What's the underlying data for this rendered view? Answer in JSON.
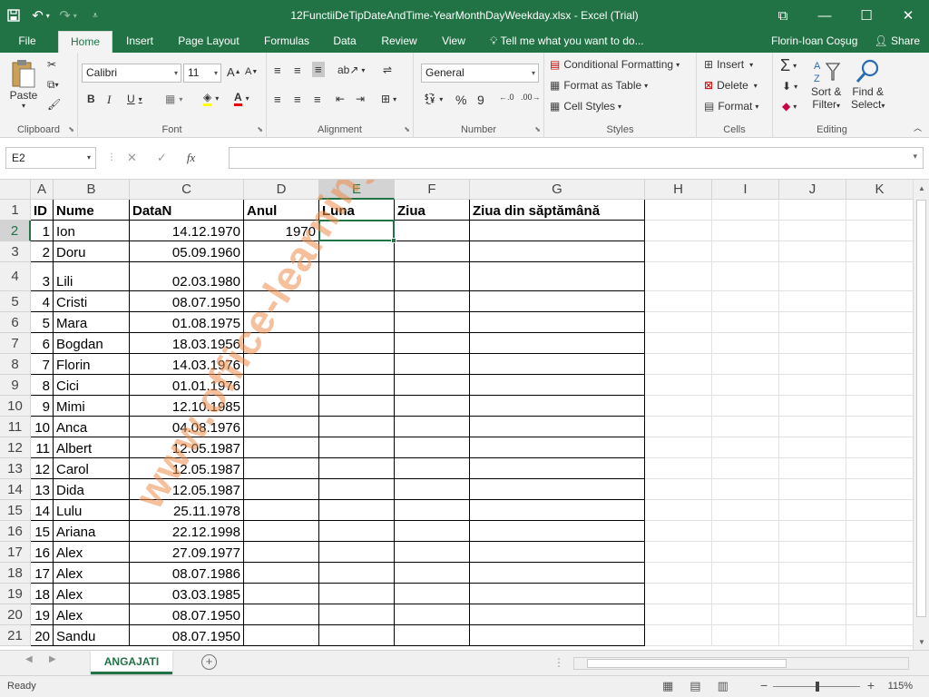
{
  "window": {
    "title": "12FunctiiDeTipDateAndTime-YearMonthDayWeekday.xlsx - Excel (Trial)",
    "save_icon": "save-icon",
    "undo_icon": "undo-icon",
    "redo_icon": "redo-icon"
  },
  "tabs": {
    "items": [
      "File",
      "Home",
      "Insert",
      "Page Layout",
      "Formulas",
      "Data",
      "Review",
      "View"
    ],
    "active": "Home",
    "tell_me": "Tell me what you want to do...",
    "user": "Florin-Ioan Coşug",
    "share": "Share"
  },
  "ribbon": {
    "clipboard": {
      "label": "Clipboard",
      "paste": "Paste"
    },
    "font": {
      "label": "Font",
      "name": "Calibri",
      "size": "11",
      "grow": "A",
      "shrink": "A",
      "bold": "B",
      "italic": "I",
      "underline": "U",
      "font_color": "A"
    },
    "alignment": {
      "label": "Alignment"
    },
    "number": {
      "label": "Number",
      "format": "General",
      "percent": "%",
      "comma": "9"
    },
    "styles": {
      "label": "Styles",
      "conditional": "Conditional Formatting",
      "format_table": "Format as Table",
      "cell_styles": "Cell Styles"
    },
    "cells": {
      "label": "Cells",
      "insert": "Insert",
      "delete": "Delete",
      "format": "Format"
    },
    "editing": {
      "label": "Editing",
      "sort1": "Sort &",
      "sort2": "Filter",
      "find1": "Find &",
      "find2": "Select",
      "sigma": "Σ"
    }
  },
  "formula_bar": {
    "name_box": "E2",
    "cancel": "✕",
    "enter": "✓",
    "fx": "fx",
    "content": ""
  },
  "sheet": {
    "columns": [
      "A",
      "B",
      "C",
      "D",
      "E",
      "F",
      "G",
      "H",
      "I",
      "J",
      "K"
    ],
    "rows": [
      "1",
      "2",
      "3",
      "4",
      "5",
      "6",
      "7",
      "8",
      "9",
      "10",
      "11",
      "12",
      "13",
      "14",
      "15",
      "16",
      "17",
      "18",
      "19",
      "20",
      "21"
    ],
    "headers": [
      "ID",
      "Nume",
      "DataN",
      "Anul",
      "Luna",
      "Ziua",
      "Ziua din săptămână"
    ],
    "data": [
      [
        "1",
        "Ion",
        "14.12.1970",
        "1970",
        "",
        "",
        ""
      ],
      [
        "2",
        "Doru",
        "05.09.1960",
        "",
        "",
        "",
        ""
      ],
      [
        "3",
        "Lili",
        "02.03.1980",
        "",
        "",
        "",
        ""
      ],
      [
        "4",
        "Cristi",
        "08.07.1950",
        "",
        "",
        "",
        ""
      ],
      [
        "5",
        "Mara",
        "01.08.1975",
        "",
        "",
        "",
        ""
      ],
      [
        "6",
        "Bogdan",
        "18.03.1956",
        "",
        "",
        "",
        ""
      ],
      [
        "7",
        "Florin",
        "14.03.1976",
        "",
        "",
        "",
        ""
      ],
      [
        "8",
        "Cici",
        "01.01.1976",
        "",
        "",
        "",
        ""
      ],
      [
        "9",
        "Mimi",
        "12.10.1985",
        "",
        "",
        "",
        ""
      ],
      [
        "10",
        "Anca",
        "04.08.1976",
        "",
        "",
        "",
        ""
      ],
      [
        "11",
        "Albert",
        "12.05.1987",
        "",
        "",
        "",
        ""
      ],
      [
        "12",
        "Carol",
        "12.05.1987",
        "",
        "",
        "",
        ""
      ],
      [
        "13",
        "Dida",
        "12.05.1987",
        "",
        "",
        "",
        ""
      ],
      [
        "14",
        "Lulu",
        "25.11.1978",
        "",
        "",
        "",
        ""
      ],
      [
        "15",
        "Ariana",
        "22.12.1998",
        "",
        "",
        "",
        ""
      ],
      [
        "16",
        "Alex",
        "27.09.1977",
        "",
        "",
        "",
        ""
      ],
      [
        "17",
        "Alex",
        "08.07.1986",
        "",
        "",
        "",
        ""
      ],
      [
        "18",
        "Alex",
        "03.03.1985",
        "",
        "",
        "",
        ""
      ],
      [
        "19",
        "Alex",
        "08.07.1950",
        "",
        "",
        "",
        ""
      ],
      [
        "20",
        "Sandu",
        "08.07.1950",
        "",
        "",
        "",
        ""
      ]
    ],
    "selected_cell": "E2",
    "watermark": "www.office-learning.ro"
  },
  "sheet_tabs": {
    "active": "ANGAJATI",
    "add": "+"
  },
  "status": {
    "ready": "Ready",
    "zoom": "115%",
    "zoom_minus": "−",
    "zoom_plus": "+"
  }
}
